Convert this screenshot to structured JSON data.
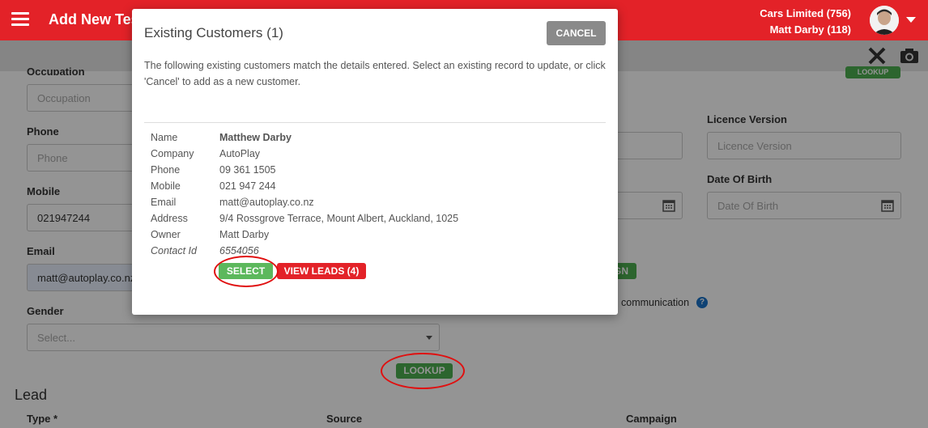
{
  "header": {
    "title": "Add New Tes",
    "account_line1": "Cars Limited (756)",
    "account_line2": "Matt Darby (118)"
  },
  "form": {
    "occupation_label": "Occupation",
    "occupation_placeholder": "Occupation",
    "phone_label": "Phone",
    "phone_placeholder": "Phone",
    "mobile_label": "Mobile",
    "mobile_value": "021947244",
    "email_label": "Email",
    "email_value": "matt@autoplay.co.nz",
    "gender_label": "Gender",
    "gender_placeholder": "Select...",
    "lookup_button": "LOOKUP",
    "licence_version_label": "Licence Version",
    "licence_version_placeholder": "Licence Version",
    "dob_label": "Date Of Birth",
    "dob_placeholder": "Date Of Birth",
    "communication_text": "communication",
    "lead_section_title": "Lead",
    "type_label": "Type *",
    "source_label": "Source",
    "campaign_label": "Campaign",
    "partial_button_top": "LOOKUP",
    "partial_button_mid": "GN"
  },
  "modal": {
    "title": "Existing Customers (1)",
    "cancel_label": "CANCEL",
    "description": "The following existing customers match the details entered. Select an existing record to update, or click 'Cancel' to add as a new customer.",
    "customer": {
      "name_key": "Name",
      "name": "Matthew Darby",
      "company_key": "Company",
      "company": "AutoPlay",
      "phone_key": "Phone",
      "phone": "09 361 1505",
      "mobile_key": "Mobile",
      "mobile": "021 947 244",
      "email_key": "Email",
      "email": "matt@autoplay.co.nz",
      "address_key": "Address",
      "address": "9/4 Rossgrove Terrace, Mount Albert, Auckland, 1025",
      "owner_key": "Owner",
      "owner": "Matt Darby",
      "contact_id_key": "Contact Id",
      "contact_id": "6554056"
    },
    "select_label": "SELECT",
    "view_leads_label": "VIEW LEADS (4)"
  },
  "colors": {
    "brand_red": "#e32228",
    "green": "#4caf50",
    "annotation_red": "#e01010"
  },
  "icons": [
    "menu-icon",
    "avatar",
    "chevron-down-icon",
    "close-icon",
    "camera-icon",
    "calendar-icon",
    "help-icon"
  ]
}
